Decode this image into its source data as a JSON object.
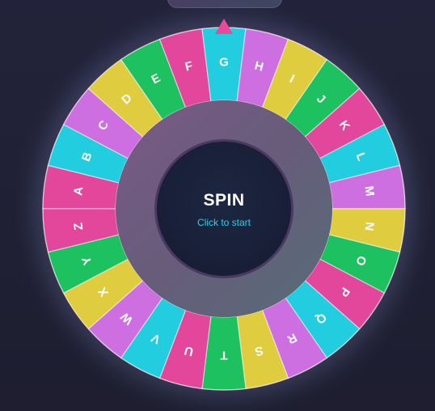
{
  "wheel": {
    "letters": [
      "A",
      "B",
      "C",
      "D",
      "E",
      "F",
      "G",
      "H",
      "I",
      "J",
      "K",
      "L",
      "M",
      "N",
      "O",
      "P",
      "Q",
      "R",
      "S",
      "T",
      "U",
      "V",
      "W",
      "X",
      "Y",
      "Z"
    ],
    "colors": [
      "pink",
      "cyan",
      "violet",
      "yellow",
      "green",
      "pink",
      "cyan",
      "violet",
      "yellow",
      "green",
      "pink",
      "cyan",
      "violet",
      "yellow",
      "green",
      "pink",
      "cyan",
      "violet",
      "yellow",
      "green",
      "pink",
      "cyan",
      "violet",
      "yellow",
      "green",
      "pink"
    ],
    "palette": {
      "pink": "#e2479b",
      "cyan": "#22cde0",
      "violet": "#cd6fe0",
      "yellow": "#dfcc3f",
      "green": "#1dc160"
    },
    "pointer_color": "#ec4899"
  },
  "hub": {
    "title": "SPIN",
    "subtitle": "Click to start"
  }
}
